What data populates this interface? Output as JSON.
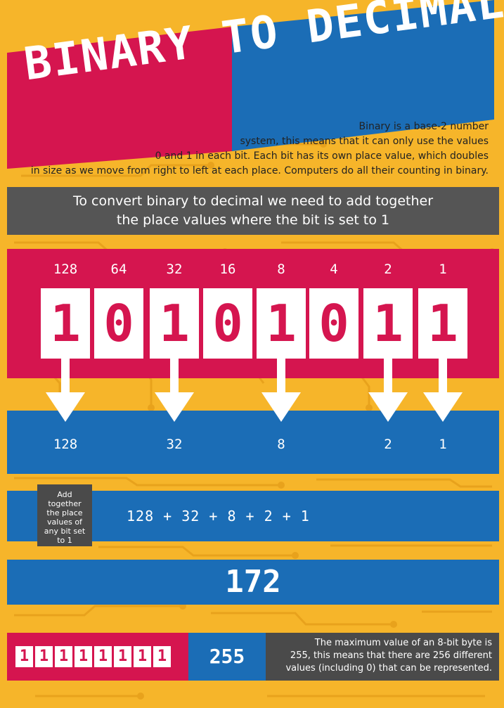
{
  "title": "BINARY TO DECIMAL",
  "intro_lines": [
    "Binary is a base-2 number",
    "system, this means that it can only use the values",
    "0 and 1 in each bit. Each bit has its own place value, which doubles",
    "in size as we move from right to left at each place. Computers do all their counting in binary."
  ],
  "instruction_lines": [
    "To convert binary to decimal we need to add together",
    "the place values where the bit is set to 1"
  ],
  "place_values": [
    "128",
    "64",
    "32",
    "16",
    "8",
    "4",
    "2",
    "1"
  ],
  "bits": [
    "1",
    "0",
    "1",
    "0",
    "1",
    "0",
    "1",
    "1"
  ],
  "selected_values": [
    "128",
    "32",
    "8",
    "2",
    "1"
  ],
  "add_label": "Add together the place values of any bit set to 1",
  "sum_expression": "128 + 32 + 8 + 2 + 1",
  "result": "172",
  "max_byte": {
    "bits": [
      "1",
      "1",
      "1",
      "1",
      "1",
      "1",
      "1",
      "1"
    ],
    "value": "255",
    "description_lines": [
      "The maximum value of an 8-bit byte is",
      "255, this means that there are 256 different",
      "values (including 0) that can be represented."
    ]
  },
  "colors": {
    "background": "#f6b52a",
    "circuit": "#e8a21c",
    "red": "#d5154f",
    "blue": "#1b6db6",
    "grey": "#555555",
    "white": "#ffffff"
  },
  "icons": [
    "down-arrow-icon"
  ]
}
